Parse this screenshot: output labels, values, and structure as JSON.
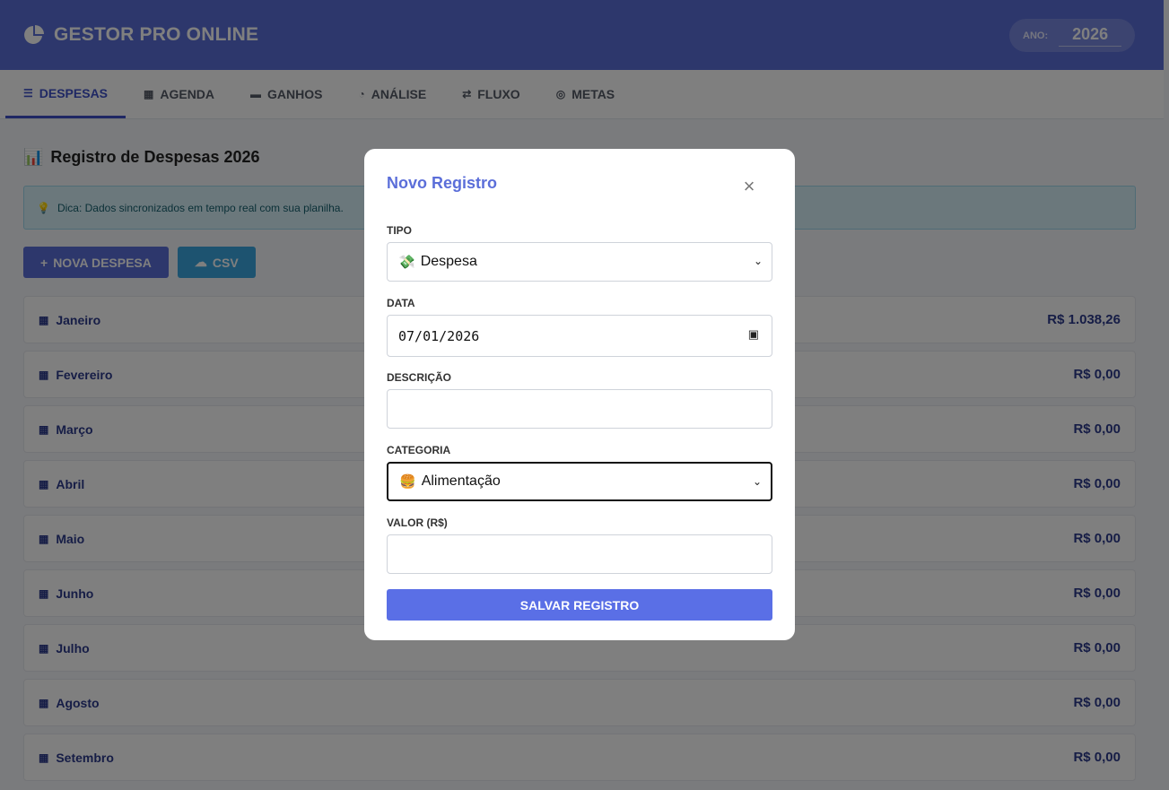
{
  "header": {
    "brand": "GESTOR PRO ONLINE",
    "year_label": "ANO:",
    "year_value": "2026",
    "color": "#5b6ed9"
  },
  "tabs": [
    {
      "label": "DESPESAS",
      "icon": "list-icon",
      "active": true
    },
    {
      "label": "AGENDA",
      "icon": "calendar-icon"
    },
    {
      "label": "GANHOS",
      "icon": "wallet-icon"
    },
    {
      "label": "ANÁLISE",
      "icon": "pie-chart-icon"
    },
    {
      "label": "FLUXO",
      "icon": "exchange-icon"
    },
    {
      "label": "METAS",
      "icon": "target-icon"
    }
  ],
  "main": {
    "title": "Registro de Despesas 2026",
    "tip": "Dica: Dados sincronizados em tempo real com sua planilha.",
    "new_expense_label": "NOVA DESPESA",
    "csv_label": "CSV"
  },
  "months": [
    {
      "name": "Janeiro",
      "total": "R$ 1.038,26"
    },
    {
      "name": "Fevereiro",
      "total": "R$ 0,00"
    },
    {
      "name": "Março",
      "total": "R$ 0,00"
    },
    {
      "name": "Abril",
      "total": "R$ 0,00"
    },
    {
      "name": "Maio",
      "total": "R$ 0,00"
    },
    {
      "name": "Junho",
      "total": "R$ 0,00"
    },
    {
      "name": "Julho",
      "total": "R$ 0,00"
    },
    {
      "name": "Agosto",
      "total": "R$ 0,00"
    },
    {
      "name": "Setembro",
      "total": "R$ 0,00"
    }
  ],
  "modal": {
    "title": "Novo Registro",
    "close": "×",
    "tipo_label": "TIPO",
    "tipo_value": "Despesa",
    "tipo_icon": "money-wings-emoji",
    "data_label": "DATA",
    "data_value": "07/01/2026",
    "descricao_label": "DESCRIÇÃO",
    "descricao_value": "",
    "categoria_label": "CATEGORIA",
    "categoria_value": "Alimentação",
    "categoria_icon": "hamburger-emoji",
    "valor_label": "VALOR (R$)",
    "valor_value": "",
    "save_label": "SALVAR REGISTRO"
  }
}
